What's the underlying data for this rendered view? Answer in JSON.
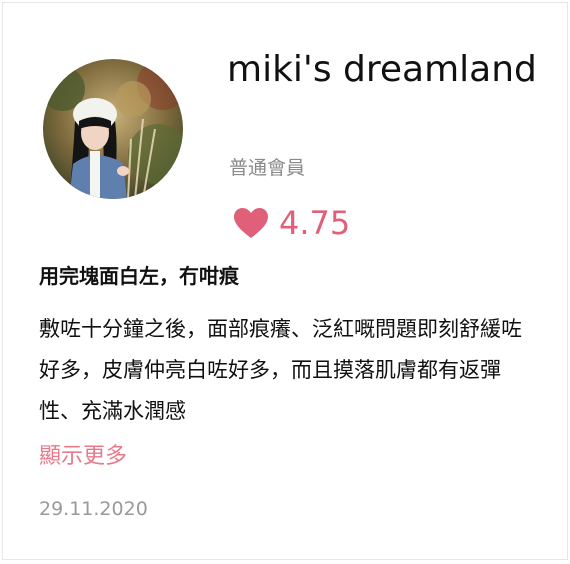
{
  "user": {
    "name": "miki's dreamland",
    "level": "普通會員"
  },
  "rating": {
    "icon": "heart-icon",
    "value": "4.75",
    "color": "#e0607a"
  },
  "review": {
    "title": "用完塊面白左，冇咁痕",
    "body": "敷咗十分鐘之後，面部痕癢、泛紅嘅問題即刻舒緩咗好多，皮膚仲亮白咗好多，而且摸落肌膚都有返彈性、充滿水潤感",
    "show_more": "顯示更多",
    "date": "29.11.2020"
  },
  "colors": {
    "accent": "#e8798a",
    "muted": "#9a9a9a"
  }
}
